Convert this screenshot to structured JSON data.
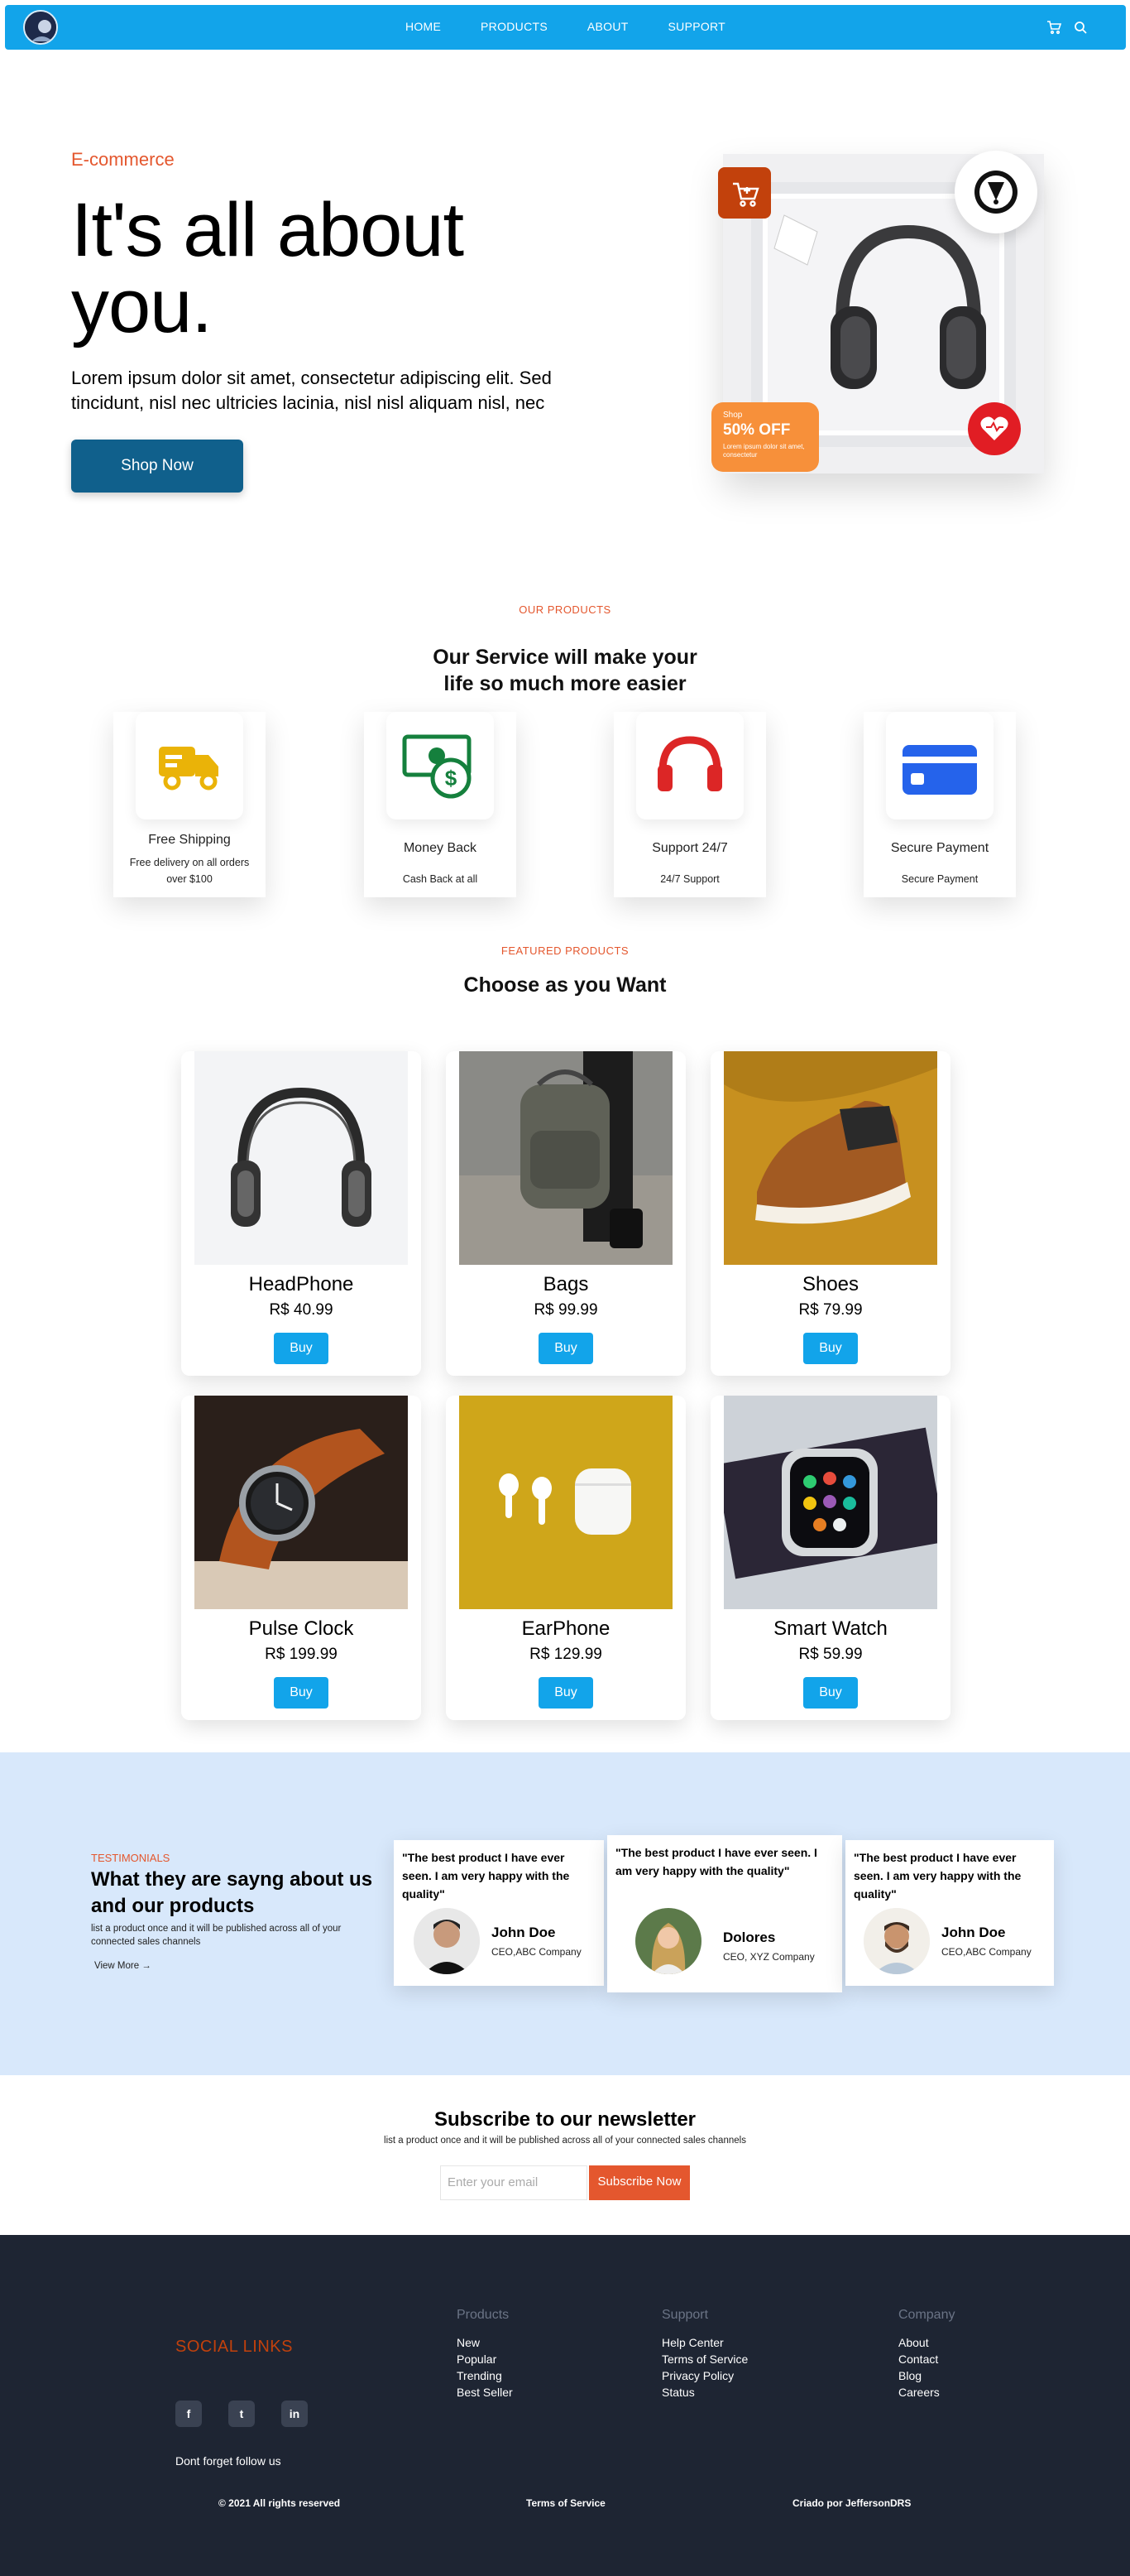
{
  "nav": {
    "links": [
      "HOME",
      "PRODUCTS",
      "ABOUT",
      "SUPPORT"
    ],
    "icons": [
      "cart-icon",
      "search-icon"
    ]
  },
  "hero": {
    "eyebrow": "E-commerce",
    "title": "It's all about you.",
    "text": "Lorem ipsum dolor sit amet, consectetur adipiscing elit. Sed tincidunt, nisl nec ultricies lacinia, nisl nisl aliquam nisl, nec",
    "cta": "Shop Now",
    "badge": {
      "small": "Shop",
      "big": "50% OFF",
      "text": "Lorem ipsum dolor sit amet, consectetur"
    }
  },
  "services": {
    "eyebrow": "OUR PRODUCTS",
    "title_line1": "Our Service will make your",
    "title_line2": "life so much more easier",
    "items": [
      {
        "title": "Free Shipping",
        "desc": "Free delivery on all orders over $100",
        "icon": "truck-icon",
        "color": "#eab308"
      },
      {
        "title": "Money Back",
        "desc": "Cash Back at all",
        "icon": "money-icon",
        "color": "#15803d"
      },
      {
        "title": "Support 24/7",
        "desc": "24/7 Support",
        "icon": "headset-icon",
        "color": "#dc2626"
      },
      {
        "title": "Secure Payment",
        "desc": "Secure Payment",
        "icon": "card-icon",
        "color": "#2563eb"
      }
    ]
  },
  "featured": {
    "eyebrow": "FEATURED PRODUCTS",
    "title": "Choose as you Want",
    "buy_label": "Buy",
    "products": [
      {
        "name": "HeadPhone",
        "price": "R$ 40.99"
      },
      {
        "name": "Bags",
        "price": "R$ 99.99"
      },
      {
        "name": "Shoes",
        "price": "R$ 79.99"
      },
      {
        "name": "Pulse Clock",
        "price": "R$ 199.99"
      },
      {
        "name": "EarPhone",
        "price": "R$ 129.99"
      },
      {
        "name": "Smart Watch",
        "price": "R$ 59.99"
      }
    ]
  },
  "testimonials": {
    "eyebrow": "TESTIMONIALS",
    "title": "What they are sayng about us and our products",
    "desc": "list a product once and it will be published across all of your connected sales channels",
    "link": "View More →",
    "items": [
      {
        "quote": "\"The best product I have ever seen. I am very happy with the quality\"",
        "name": "John Doe",
        "role": "CEO,ABC Company"
      },
      {
        "quote": "\"The best product I have ever seen. I am very happy with the quality\"",
        "name": "Dolores",
        "role": "CEO, XYZ Company"
      },
      {
        "quote": "\"The best product I have ever seen. I am very happy with the quality\"",
        "name": "John Doe",
        "role": "CEO,ABC Company"
      }
    ]
  },
  "newsletter": {
    "title": "Subscribe to our newsletter",
    "desc": "list a product once and it will be published across all of your connected sales channels",
    "placeholder": "Enter your email",
    "button": "Subscribe Now"
  },
  "footer": {
    "social_title": "SOCIAL LINKS",
    "social": [
      "f",
      "t",
      "in"
    ],
    "follow": "Dont forget follow us",
    "columns": [
      {
        "title": "Products",
        "links": [
          "New",
          "Popular",
          "Trending",
          "Best Seller"
        ]
      },
      {
        "title": "Support",
        "links": [
          "Help Center",
          "Terms of Service",
          "Privacy Policy",
          "Status"
        ]
      },
      {
        "title": "Company",
        "links": [
          "About",
          "Contact",
          "Blog",
          "Careers"
        ]
      }
    ],
    "copyright": "© 2021 All rights reserved",
    "terms": "Terms of Service",
    "credit": "Criado por JeffersonDRS"
  },
  "colors": {
    "primary": "#12a4ea",
    "accent": "#e4572e",
    "dark": "#1e2533",
    "button": "#10608c"
  }
}
